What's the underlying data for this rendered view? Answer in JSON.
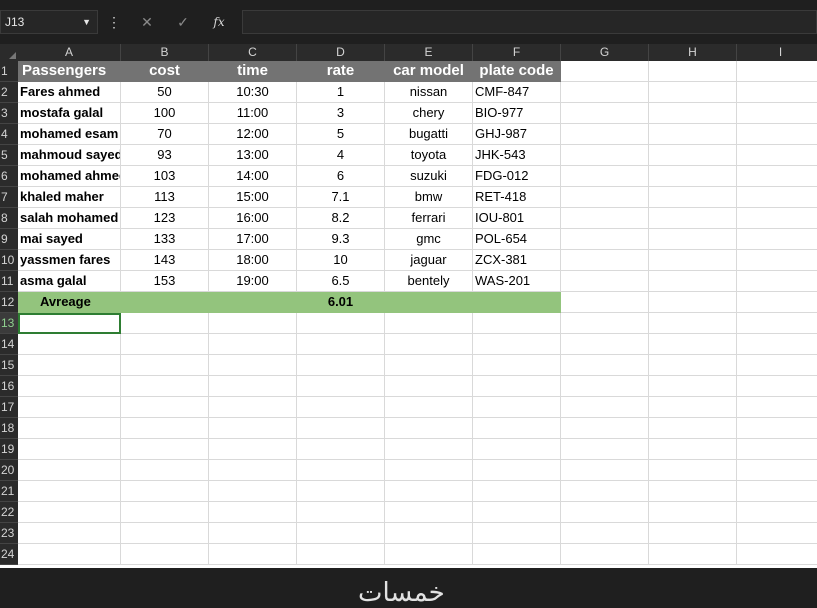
{
  "namebox": "J13",
  "formula_icons": {
    "cancel": "✕",
    "enter": "✓",
    "fx": "fx"
  },
  "columns": [
    "A",
    "B",
    "C",
    "D",
    "E",
    "F",
    "G",
    "H",
    "I"
  ],
  "rows": [
    "1",
    "2",
    "3",
    "4",
    "5",
    "6",
    "7",
    "8",
    "9",
    "10",
    "11",
    "12",
    "13",
    "14",
    "15",
    "16",
    "17",
    "18",
    "19",
    "20",
    "21",
    "22",
    "23",
    "24"
  ],
  "headers": [
    "Passengers",
    "cost",
    "time",
    "rate",
    "car model",
    "plate code"
  ],
  "table": [
    [
      "Fares ahmed",
      "50",
      "10:30",
      "1",
      "nissan",
      "CMF-847"
    ],
    [
      "mostafa galal",
      "100",
      "11:00",
      "3",
      "chery",
      "BIO-977"
    ],
    [
      "mohamed esam",
      "70",
      "12:00",
      "5",
      "bugatti",
      "GHJ-987"
    ],
    [
      "mahmoud sayed",
      "93",
      "13:00",
      "4",
      "toyota",
      "JHK-543"
    ],
    [
      "mohamed ahmed",
      "103",
      "14:00",
      "6",
      "suzuki",
      "FDG-012"
    ],
    [
      "khaled maher",
      "113",
      "15:00",
      "7.1",
      "bmw",
      "RET-418"
    ],
    [
      "salah mohamed",
      "123",
      "16:00",
      "8.2",
      "ferrari",
      "IOU-801"
    ],
    [
      "mai sayed",
      "133",
      "17:00",
      "9.3",
      "gmc",
      "POL-654"
    ],
    [
      "yassmen fares",
      "143",
      "18:00",
      "10",
      "jaguar",
      "ZCX-381"
    ],
    [
      "asma galal",
      "153",
      "19:00",
      "6.5",
      "bentely",
      "WAS-201"
    ]
  ],
  "average": {
    "label": "Avreage",
    "value": "6.01"
  },
  "watermark": "خمسات",
  "colors": {
    "header_bg": "#737373",
    "avg_bg": "#93c47d",
    "selection": "#2e7d32"
  }
}
